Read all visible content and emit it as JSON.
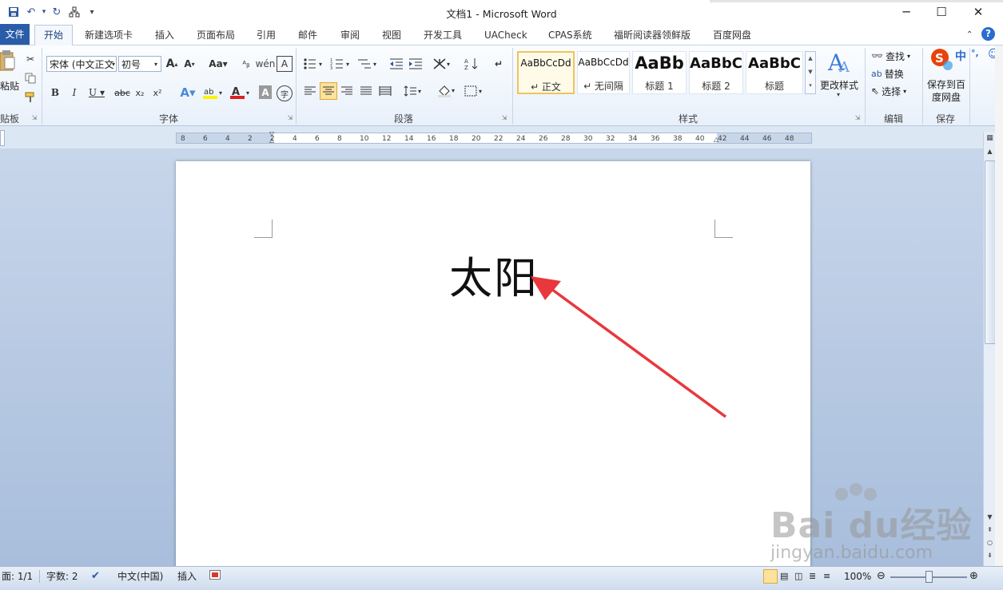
{
  "window": {
    "title": "文档1 - Microsoft Word"
  },
  "tabs": {
    "file": "文件",
    "home": "开始",
    "others": [
      "新建选项卡",
      "插入",
      "页面布局",
      "引用",
      "邮件",
      "审阅",
      "视图",
      "开发工具",
      "UACheck",
      "CPAS系统",
      "福昕阅读器领鲜版",
      "百度网盘"
    ]
  },
  "ribbon": {
    "clipboard": {
      "paste": "粘贴",
      "label": "贴板"
    },
    "font": {
      "name": "宋体 (中文正文",
      "size": "初号",
      "label": "字体"
    },
    "paragraph": {
      "label": "段落"
    },
    "styles": {
      "items": [
        {
          "sample": "AaBbCcDd",
          "name": "↵ 正文"
        },
        {
          "sample": "AaBbCcDd",
          "name": "↵ 无间隔"
        },
        {
          "sample": "AaBb",
          "name": "标题 1"
        },
        {
          "sample": "AaBbC",
          "name": "标题 2"
        },
        {
          "sample": "AaBbC",
          "name": "标题"
        }
      ],
      "change": "更改样式",
      "label": "样式"
    },
    "editing": {
      "find": "查找",
      "replace": "替换",
      "select": "选择",
      "label": "编辑"
    },
    "save": {
      "button_line1": "保存到百",
      "button_line2": "度网盘",
      "label": "保存"
    }
  },
  "ruler": {
    "ticks": [
      "8",
      "6",
      "4",
      "2",
      "2",
      "4",
      "6",
      "8",
      "10",
      "12",
      "14",
      "16",
      "18",
      "20",
      "22",
      "24",
      "26",
      "28",
      "30",
      "32",
      "34",
      "36",
      "38",
      "40",
      "42",
      "44",
      "46",
      "48"
    ]
  },
  "document": {
    "text": "太阳"
  },
  "statusbar": {
    "page": "面: 1/1",
    "words": "字数: 2",
    "language": "中文(中国)",
    "mode": "插入",
    "zoom": "100%"
  },
  "ime": {
    "cn": "中",
    "punct": "°,"
  },
  "watermark": {
    "brand": "Bai du经验",
    "url": "jingyan.baidu.com"
  },
  "colors": {
    "accent": "#2a5ca8",
    "arrow": "#e8383d"
  }
}
